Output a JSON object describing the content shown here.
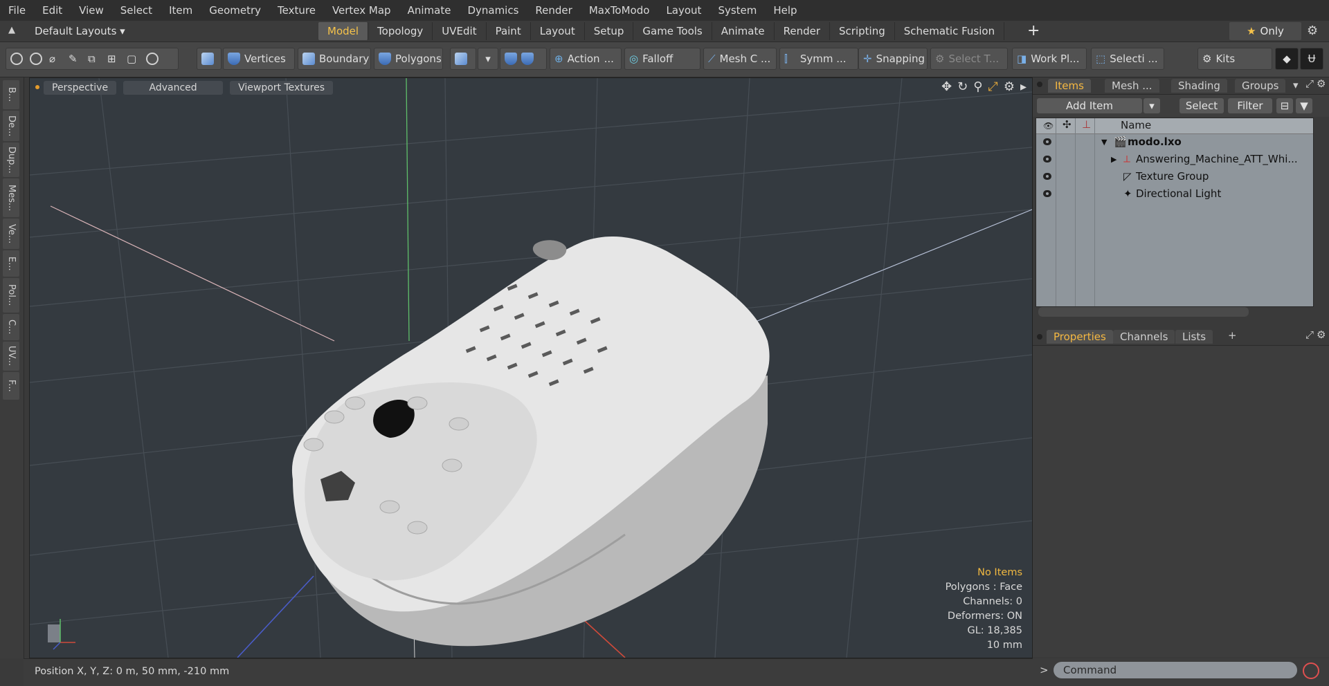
{
  "menu": [
    "File",
    "Edit",
    "View",
    "Select",
    "Item",
    "Geometry",
    "Texture",
    "Vertex Map",
    "Animate",
    "Dynamics",
    "Render",
    "MaxToModo",
    "Layout",
    "System",
    "Help"
  ],
  "layout_select": "Default Layouts ▾",
  "layout_tabs": [
    "Model",
    "Topology",
    "UVEdit",
    "Paint",
    "Layout",
    "Setup",
    "Game Tools",
    "Animate",
    "Render",
    "Scripting",
    "Schematic Fusion"
  ],
  "active_layout_tab": "Model",
  "only_label": "Only",
  "toolbar": {
    "vertices": "Vertices",
    "boundary": "Boundary",
    "polygons": "Polygons",
    "action": "Action",
    "falloff": "Falloff",
    "mesh_c": "Mesh C ...",
    "symm": "Symm ...",
    "snapping": "Snapping",
    "select_t": "Select T...",
    "work_pl": "Work Pl...",
    "selecti": "Selecti ...",
    "kits": "Kits"
  },
  "left_tabs": [
    "B...",
    "De...",
    "Dup...",
    "Mes...",
    "Ve...",
    "E...",
    "Pol...",
    "C...",
    "UV...",
    "F..."
  ],
  "viewport": {
    "header": [
      "Perspective",
      "Advanced",
      "Viewport Textures"
    ],
    "info": {
      "no_items": "No Items",
      "polygons": "Polygons : Face",
      "channels": "Channels: 0",
      "deformers": "Deformers: ON",
      "gl": "GL: 18,385",
      "scale": "10 mm"
    }
  },
  "status": "Position X, Y, Z:   0 m, 50 mm, -210 mm",
  "items_panel": {
    "tabs": [
      "Items",
      "Mesh ...",
      "Shading",
      "Groups"
    ],
    "add_item": "Add Item",
    "select": "Select",
    "filter": "Filter",
    "name_header": "Name",
    "rows": [
      "modo.lxo",
      "Answering_Machine_ATT_Whi...",
      "Texture Group",
      "Directional Light"
    ]
  },
  "props_panel": {
    "tabs": [
      "Properties",
      "Channels",
      "Lists"
    ]
  },
  "command_placeholder": "Command",
  "colors": {
    "accent": "#f5c24a",
    "viewport_bg": "#343a40",
    "list_bg": "#8f969c"
  }
}
